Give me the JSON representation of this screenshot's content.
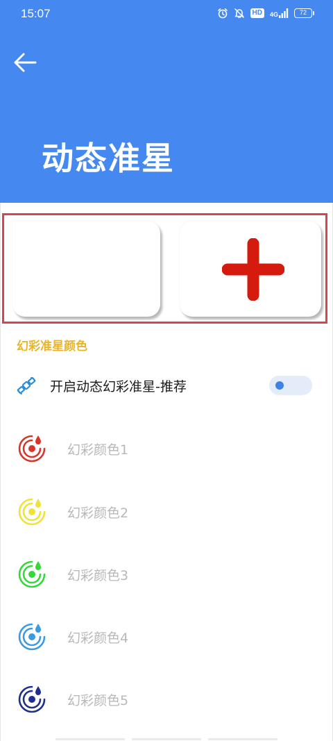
{
  "status_bar": {
    "time": "15:07",
    "network": "4G",
    "hd_badge": "HD",
    "battery": "72",
    "icons": [
      "alarm-icon",
      "bell-off-icon",
      "hd-icon",
      "signal-icon",
      "battery-icon"
    ]
  },
  "header": {
    "title": "动态准星",
    "back_icon": "arrow-left-icon",
    "background_color": "#4588F0"
  },
  "preview": {
    "frame_color": "#D9434C",
    "crosshair_color": "#D51A0E",
    "crosshair_icon": "plus-crosshair-icon"
  },
  "section": {
    "title": "幻彩准星颜色",
    "title_color": "#E9B428"
  },
  "settings": {
    "dynamic_toggle": {
      "label": "开启动态幻彩准星-推荐",
      "icon": "satellite-icon",
      "enabled": false
    },
    "colors": [
      {
        "label": "幻彩颜色1",
        "icon": "color-drop-icon",
        "color": "#D9362B"
      },
      {
        "label": "幻彩颜色2",
        "icon": "color-drop-icon",
        "color": "#F0E23A"
      },
      {
        "label": "幻彩颜色3",
        "icon": "color-drop-icon",
        "color": "#35D83A"
      },
      {
        "label": "幻彩颜色4",
        "icon": "color-drop-icon",
        "color": "#3C9BE0"
      },
      {
        "label": "幻彩颜色5",
        "icon": "color-drop-icon",
        "color": "#1E2F8C"
      }
    ]
  }
}
